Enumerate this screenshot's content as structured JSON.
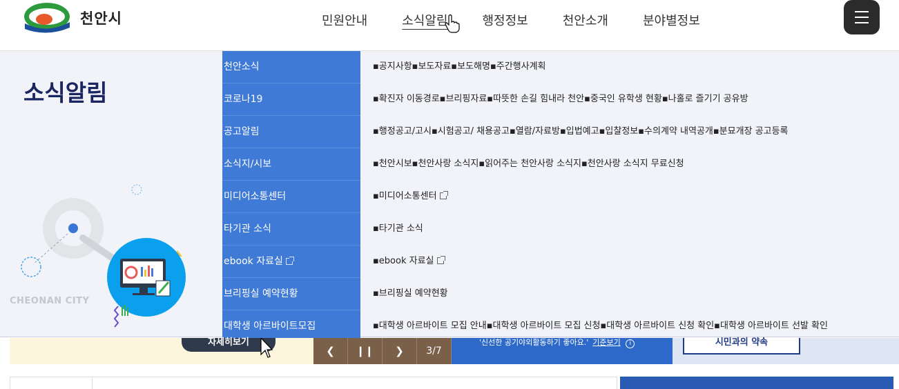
{
  "brand": {
    "name": "천안시"
  },
  "nav": [
    {
      "label": "민원안내",
      "active": false
    },
    {
      "label": "소식알림",
      "active": true
    },
    {
      "label": "행정정보",
      "active": false
    },
    {
      "label": "천안소개",
      "active": false
    },
    {
      "label": "분야별정보",
      "active": false
    }
  ],
  "mega_menu": {
    "title": "소식알림",
    "illustration_label": "CHEONAN CITY",
    "items": [
      {
        "label": "천안소식",
        "external": false,
        "subs": "▪공지사항▪보도자료▪보도해명▪주간행사계획",
        "sub_external": false
      },
      {
        "label": "코로나19",
        "external": false,
        "subs": "▪확진자 이동경로▪브리핑자료▪따뜻한 손길 힘내라 천안▪중국인 유학생 현황▪나홀로 즐기기 공유방",
        "sub_external": false
      },
      {
        "label": "공고알림",
        "external": false,
        "subs": "▪행정공고/고시▪시험공고/ 채용공고▪열람/자료방▪입법예고▪입찰정보▪수의계약 내역공개▪분묘개장 공고등록",
        "sub_external": false
      },
      {
        "label": "소식지/시보",
        "external": false,
        "subs": "▪천안시보▪천안사랑 소식지▪읽어주는 천안사랑 소식지▪천안사랑 소식지 무료신청",
        "sub_external": false
      },
      {
        "label": "미디어소통센터",
        "external": false,
        "subs": "▪미디어소통센터",
        "sub_external": true
      },
      {
        "label": "타기관 소식",
        "external": false,
        "subs": "▪타기관 소식",
        "sub_external": false
      },
      {
        "label": "ebook 자료실",
        "external": true,
        "subs": "▪ebook 자료실",
        "sub_external": true
      },
      {
        "label": "브리핑실 예약현황",
        "external": false,
        "subs": "▪브리핑실 예약현황",
        "sub_external": false
      },
      {
        "label": "대학생 아르바이트모집",
        "external": false,
        "subs": "▪대학생 아르바이트 모집 안내▪대학생 아르바이트 모집 신청▪대학생 아르바이트 신청 확인▪대학생 아르바이트 선발 확인",
        "sub_external": false
      }
    ]
  },
  "background": {
    "detail_button": "자세히보기",
    "slide_counter": "3/7",
    "slide_text": "'신선한 공기야외활동하기 좋아요.'",
    "slide_link": "기준보기",
    "promise_button": "시민과의 약속"
  },
  "colors": {
    "menu_blue": "#3f7ad6",
    "title_navy": "#1b2560",
    "panel_bg": "#f1f3f8",
    "illustration_blue": "#0aa0ee"
  },
  "icons": {
    "hamburger": "hamburger-icon",
    "external": "external-link-icon",
    "prev": "chevron-left-icon",
    "next": "chevron-right-icon",
    "pause": "pause-icon",
    "info": "info-icon",
    "cursor": "hand-cursor-icon"
  }
}
